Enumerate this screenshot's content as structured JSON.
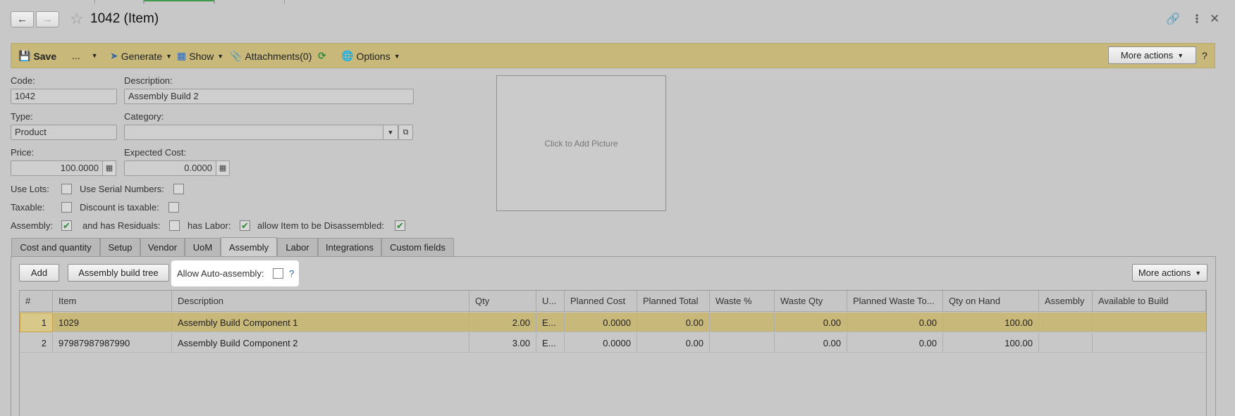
{
  "window": {
    "title": "1042 (Item)"
  },
  "toolbar": {
    "save": "Save",
    "more_dots": "...",
    "generate": "Generate",
    "show": "Show",
    "attachments": "Attachments(0)",
    "options": "Options",
    "more_actions": "More actions",
    "help": "?"
  },
  "form": {
    "code_label": "Code:",
    "code_value": "1042",
    "description_label": "Description:",
    "description_value": "Assembly Build 2",
    "type_label": "Type:",
    "type_value": "Product",
    "category_label": "Category:",
    "category_value": "",
    "price_label": "Price:",
    "price_value": "100.0000",
    "expected_cost_label": "Expected Cost:",
    "expected_cost_value": "0.0000",
    "use_lots_label": "Use Lots:",
    "use_serial_label": "Use Serial Numbers:",
    "taxable_label": "Taxable:",
    "discount_taxable_label": "Discount is taxable:",
    "assembly_label": "Assembly:",
    "has_residuals_label": "and has Residuals:",
    "has_labor_label": "has Labor:",
    "allow_disassembled_label": "allow Item to be Disassembled:",
    "picture_text": "Click to Add Picture"
  },
  "checks": {
    "use_lots": false,
    "use_serial": false,
    "taxable": false,
    "discount_taxable": false,
    "assembly": true,
    "has_residuals": false,
    "has_labor": true,
    "allow_disassembled": true,
    "allow_auto_assembly": false
  },
  "tabs": [
    "Cost and quantity",
    "Setup",
    "Vendor",
    "UoM",
    "Assembly",
    "Labor",
    "Integrations",
    "Custom fields"
  ],
  "assembly_panel": {
    "add": "Add",
    "build_tree": "Assembly build tree",
    "allow_auto_label": "Allow Auto-assembly:",
    "allow_auto_help": "?",
    "more_actions": "More actions"
  },
  "table": {
    "columns": [
      "#",
      "Item",
      "Description",
      "Qty",
      "U...",
      "Planned Cost",
      "Planned Total",
      "Waste %",
      "Waste Qty",
      "Planned Waste To...",
      "Qty on Hand",
      "Assembly",
      "Available to Build"
    ],
    "rows": [
      [
        "1",
        "1029",
        "Assembly Build Component 1",
        "2.00",
        "E...",
        "0.0000",
        "0.00",
        "",
        "0.00",
        "0.00",
        "100.00",
        "",
        ""
      ],
      [
        "2",
        "97987987987990",
        "Assembly Build Component 2",
        "3.00",
        "E...",
        "0.0000",
        "0.00",
        "",
        "0.00",
        "0.00",
        "100.00",
        "",
        ""
      ]
    ]
  },
  "colors": {
    "toolbar_bg": "#c8b87a",
    "selected_row": "#c8b87a",
    "check_green": "#2f8a3a"
  }
}
